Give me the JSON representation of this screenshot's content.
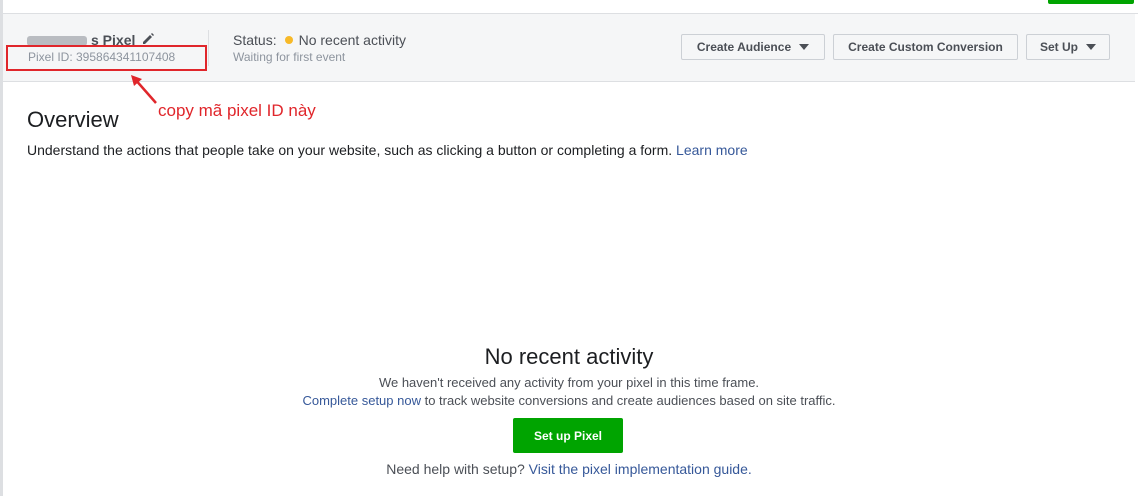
{
  "header": {
    "pixel_name": "s Pixel",
    "pixel_id": "Pixel ID: 395864341107408",
    "status_label": "Status:",
    "status_value": "No recent activity",
    "status_sub": "Waiting for first event",
    "status_color": "#f7b928",
    "buttons": {
      "create_audience": "Create Audience",
      "create_conversion": "Create Custom Conversion",
      "set_up": "Set Up"
    }
  },
  "annotation": {
    "text": "copy mã pixel ID này",
    "color": "#e0262b"
  },
  "overview": {
    "title": "Overview",
    "description": "Understand the actions that people take on your website, such as clicking a button or completing a form.",
    "learn_more": "Learn more"
  },
  "empty_state": {
    "title": "No recent activity",
    "line1": "We haven't received any activity from your pixel in this time frame.",
    "complete_setup_link": "Complete setup now",
    "line2_rest": " to track website conversions and create audiences based on site traffic.",
    "setup_button": "Set up Pixel",
    "help_prefix": "Need help with setup? ",
    "help_link": "Visit the pixel implementation guide."
  },
  "colors": {
    "primary_green": "#00a400",
    "link": "#365899",
    "header_bg": "#f5f6f7"
  }
}
